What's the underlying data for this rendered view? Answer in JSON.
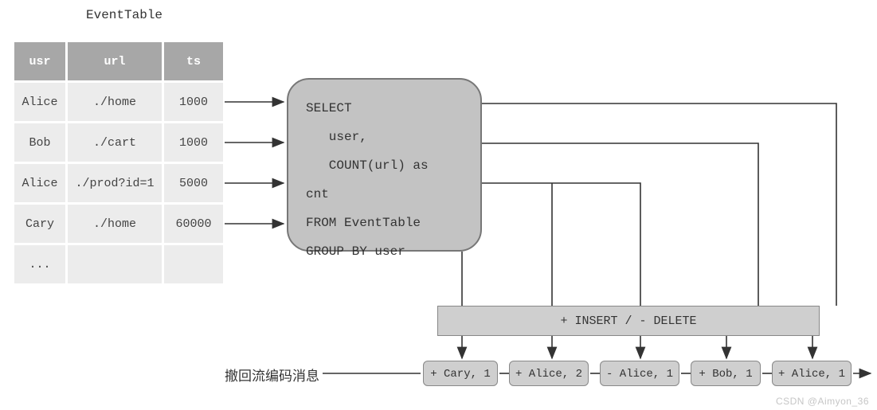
{
  "table": {
    "title": "EventTable",
    "headers": {
      "usr": "usr",
      "url": "url",
      "ts": "ts"
    },
    "rows": [
      {
        "usr": "Alice",
        "url": "./home",
        "ts": "1000"
      },
      {
        "usr": "Bob",
        "url": "./cart",
        "ts": "1000"
      },
      {
        "usr": "Alice",
        "url": "./prod?id=1",
        "ts": "5000"
      },
      {
        "usr": "Cary",
        "url": "./home",
        "ts": "60000"
      },
      {
        "usr": "...",
        "url": "",
        "ts": ""
      }
    ]
  },
  "sql": {
    "line1": "SELECT",
    "line2": "   user,",
    "line3": "   COUNT(url) as",
    "line4": "cnt",
    "line5": "FROM EventTable",
    "line6": "GROUP BY user"
  },
  "insdel": {
    "label": "+ INSERT / - DELETE"
  },
  "results": {
    "r1": "+ Cary, 1",
    "r2": "+ Alice, 2",
    "r3": "- Alice, 1",
    "r4": "+ Bob, 1",
    "r5": "+ Alice, 1"
  },
  "retract_label": "撤回流编码消息",
  "watermark": "CSDN @Aimyon_36"
}
